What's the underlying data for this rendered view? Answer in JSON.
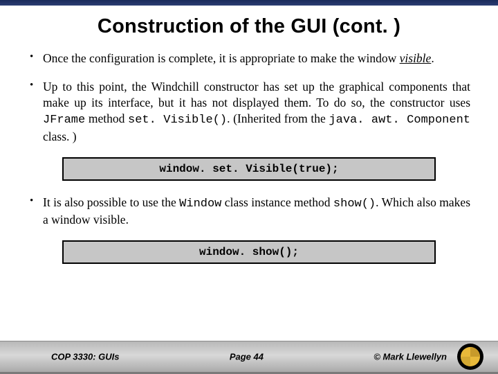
{
  "title": "Construction of the GUI (cont. )",
  "bullets": {
    "b1_a": "Once the configuration is complete, it is appropriate to make the window ",
    "b1_visible": "visible",
    "b1_b": ".",
    "b2_a": "Up to this point, the Windchill constructor has set up the graphical components that make up its interface, but it has not displayed them.  To do so, the constructor uses ",
    "b2_code1": "JFrame",
    "b2_b": " method ",
    "b2_code2": "set. Visible()",
    "b2_c": ". (Inherited from the ",
    "b2_code3": "java. awt. Component",
    "b2_d": " class. )",
    "b3_a": "It is also possible to use the ",
    "b3_code1": "Window",
    "b3_b": " class instance method ",
    "b3_code2": "show()",
    "b3_c": ". Which also makes a window visible."
  },
  "code1": "window. set. Visible(true);",
  "code2": "window. show();",
  "footer": {
    "left": "COP 3330:  GUIs",
    "center": "Page 44",
    "right": "© Mark Llewellyn"
  }
}
